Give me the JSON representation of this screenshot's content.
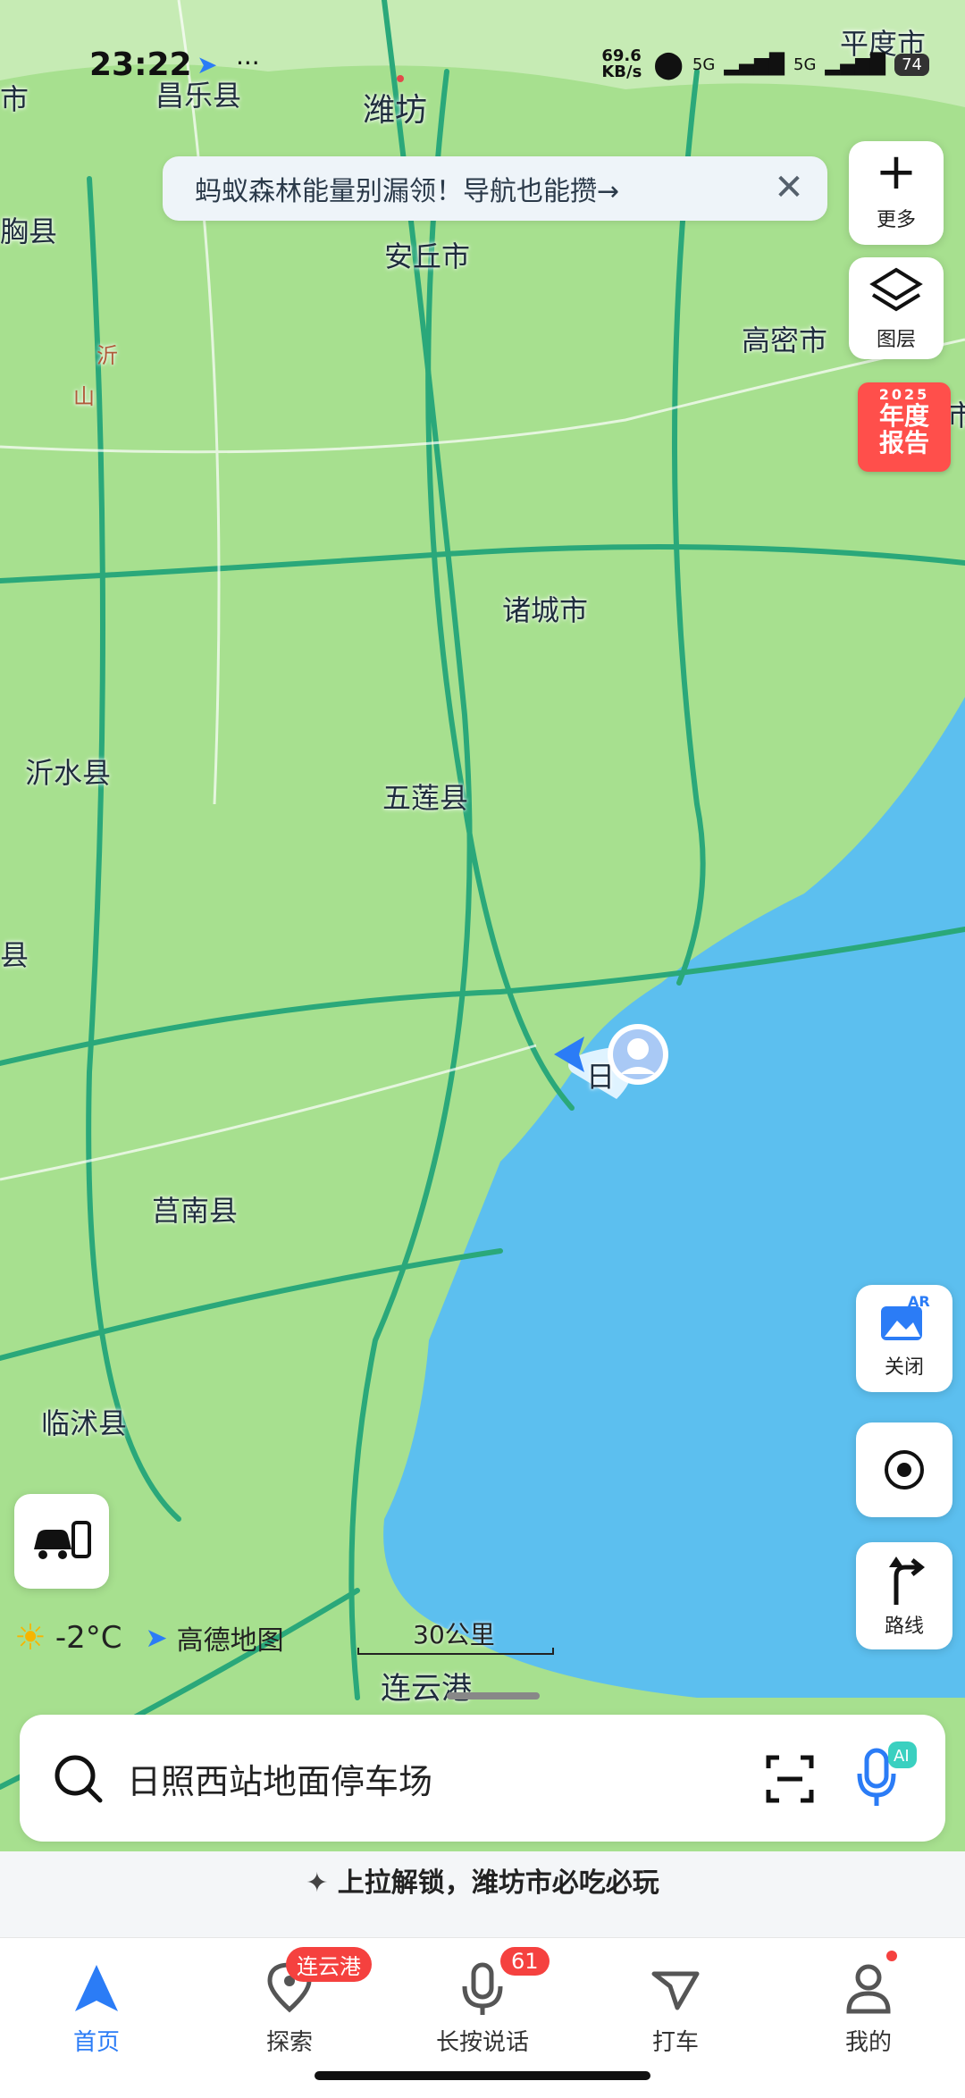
{
  "status_bar": {
    "time": "23:22",
    "speed": "69.6 KB/s",
    "sig1": "5G",
    "sig2": "5G",
    "battery": "74"
  },
  "banner": {
    "text": "蚂蚁森林能量别漏领！导航也能攒→"
  },
  "side_controls": {
    "more_label": "更多",
    "layers_label": "图层",
    "annual_year": "2025",
    "annual_line1": "年度",
    "annual_line2": "报告",
    "ar_label": "关闭",
    "route_label": "路线"
  },
  "map_labels": {
    "l1": "平度市",
    "l2": "昌乐县",
    "l3": "潍坊",
    "l4": "市",
    "l5": "胸县",
    "l6": "安丘市",
    "l7": "高密市",
    "l8": "诸城市",
    "l9": "沂水县",
    "l10": "五莲县",
    "l11": "县",
    "l12": "莒南县",
    "l13": "临沭县",
    "l14": "连云港",
    "l15": "沂",
    "l16": "山",
    "l17": "市",
    "l18": "日"
  },
  "weather": {
    "temp": "-2°C",
    "brand": "高德地图"
  },
  "scale": {
    "text": "30公里"
  },
  "search": {
    "text": "日照西站地面停车场"
  },
  "promo": {
    "text": "上拉解锁，潍坊市必吃必玩"
  },
  "tabs": [
    {
      "label": "首页",
      "badge": ""
    },
    {
      "label": "探索",
      "badge": "连云港"
    },
    {
      "label": "长按说话",
      "badge": "61"
    },
    {
      "label": "打车",
      "badge": ""
    },
    {
      "label": "我的",
      "badge": ""
    }
  ],
  "colors": {
    "land": "#9fdc8c",
    "sea": "#5cbfef",
    "road": "#2aa87a",
    "accent": "#2b7cf6"
  }
}
